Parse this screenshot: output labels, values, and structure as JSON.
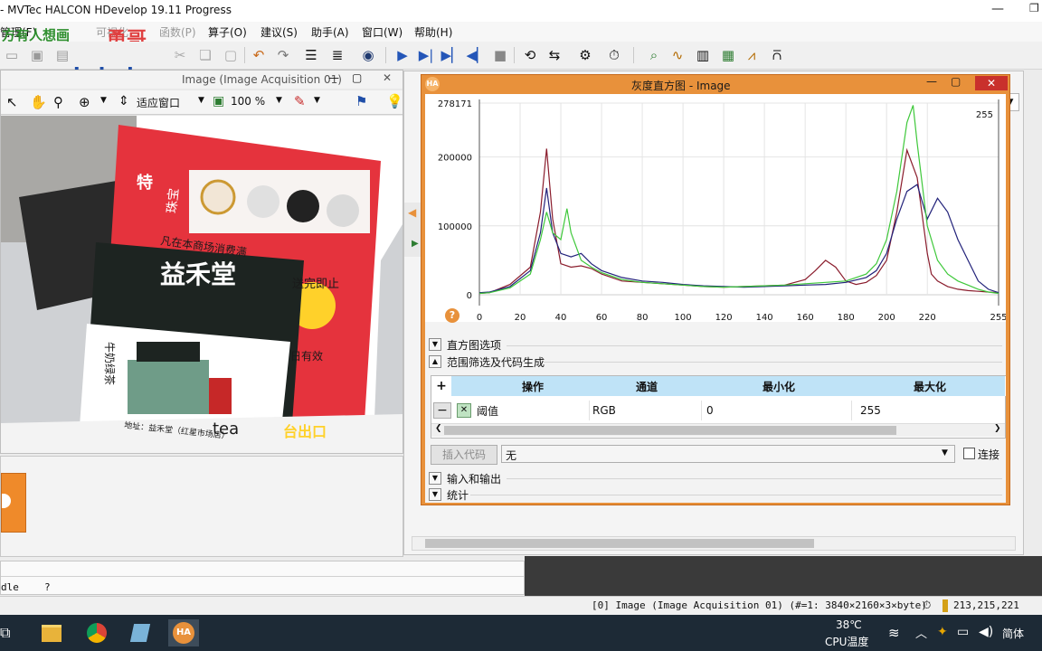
{
  "window": {
    "title": "- MVTec HALCON HDevelop 19.11 Progress",
    "watermark_left": "方有人想画",
    "watermark_brand": "勇哥",
    "watermark_url": "www.skcircle.com"
  },
  "menu": [
    {
      "label": "管理(F)"
    },
    {
      "label": "可视化"
    },
    {
      "label": "函数(P)"
    },
    {
      "label": "算子(O)"
    },
    {
      "label": "建议(S)"
    },
    {
      "label": "助手(A)"
    },
    {
      "label": "窗口(W)"
    },
    {
      "label": "帮助(H)"
    }
  ],
  "graphics_window": {
    "title": "Image (Image Acquisition 01)",
    "fit_label": "适应窗口",
    "zoom": "100 %",
    "photo_texts": {
      "brand": "益禾堂",
      "jewel": "珠宝",
      "special": "特",
      "promo": "凡在本商场消费满",
      "gift": "送完即止",
      "tea": "牛奶绿茶",
      "tea2": "tea",
      "valid": "日有效",
      "exit": "台出口",
      "addr": "地址：益禾堂（红星市场店）"
    }
  },
  "histogram": {
    "title": "灰度直方图 - Image",
    "sections": {
      "options": "直方图选项",
      "range": "范围筛选及代码生成",
      "io": "输入和输出",
      "stats": "统计"
    },
    "table": {
      "headers": [
        "操作",
        "通道",
        "最小化",
        "最大化"
      ],
      "rows": [
        {
          "op": "阈值",
          "channel": "RGB",
          "min": "0",
          "max": "255"
        }
      ]
    },
    "insert_code": "插入代码",
    "code_target": "无",
    "connect_label": "连接",
    "add_symbol": "+",
    "remove_symbol": "−"
  },
  "chart_data": {
    "type": "line",
    "x_ticks": [
      "0",
      "20",
      "40",
      "60",
      "80",
      "100",
      "120",
      "140",
      "160",
      "180",
      "200",
      "220",
      "255"
    ],
    "y_ticks": [
      "0",
      "100000",
      "200000",
      "278171"
    ],
    "marker_right": "255",
    "xlim": [
      0,
      255
    ],
    "ylim": [
      0,
      278171
    ],
    "grid": true,
    "series": [
      {
        "color": "#8a1c2c",
        "x": [
          0,
          5,
          15,
          25,
          30,
          33,
          36,
          40,
          45,
          50,
          55,
          60,
          70,
          80,
          90,
          100,
          110,
          120,
          130,
          140,
          150,
          160,
          165,
          170,
          175,
          180,
          185,
          190,
          195,
          200,
          205,
          210,
          215,
          220,
          222,
          225,
          230,
          235,
          240,
          245,
          250,
          255
        ],
        "y": [
          2000,
          3000,
          15000,
          40000,
          120000,
          212000,
          110000,
          45000,
          40000,
          42000,
          38000,
          30000,
          20000,
          18000,
          16000,
          14000,
          12000,
          11000,
          12000,
          13000,
          14000,
          22000,
          35000,
          50000,
          40000,
          20000,
          15000,
          18000,
          28000,
          50000,
          120000,
          210000,
          170000,
          60000,
          30000,
          20000,
          12000,
          8000,
          6000,
          5000,
          4000,
          3000
        ]
      },
      {
        "color": "#22227a",
        "x": [
          0,
          5,
          15,
          25,
          30,
          33,
          36,
          40,
          45,
          50,
          55,
          60,
          70,
          80,
          90,
          100,
          110,
          120,
          130,
          140,
          150,
          160,
          170,
          180,
          190,
          195,
          200,
          205,
          210,
          215,
          220,
          225,
          230,
          235,
          240,
          245,
          250,
          255
        ],
        "y": [
          3000,
          4000,
          12000,
          35000,
          90000,
          155000,
          90000,
          60000,
          55000,
          60000,
          45000,
          35000,
          25000,
          20000,
          18000,
          15000,
          13000,
          12000,
          11000,
          12000,
          13000,
          14000,
          15000,
          18000,
          25000,
          35000,
          60000,
          110000,
          150000,
          160000,
          110000,
          140000,
          120000,
          80000,
          50000,
          20000,
          8000,
          3000
        ]
      },
      {
        "color": "#3ec83a",
        "x": [
          0,
          5,
          15,
          25,
          30,
          33,
          36,
          40,
          43,
          45,
          50,
          55,
          60,
          70,
          80,
          90,
          100,
          110,
          120,
          130,
          140,
          150,
          160,
          170,
          180,
          190,
          195,
          200,
          205,
          210,
          213,
          215,
          220,
          225,
          230,
          235,
          240,
          245,
          250,
          255
        ],
        "y": [
          2000,
          3000,
          10000,
          30000,
          80000,
          120000,
          90000,
          80000,
          125000,
          90000,
          50000,
          40000,
          32000,
          22000,
          18000,
          16000,
          14000,
          12000,
          11000,
          12000,
          13000,
          14000,
          16000,
          18000,
          20000,
          30000,
          45000,
          80000,
          150000,
          250000,
          275000,
          220000,
          100000,
          50000,
          30000,
          20000,
          14000,
          8000,
          4000,
          2000
        ]
      }
    ]
  },
  "status_bar": {
    "info": "[0] Image (Image Acquisition 01) (#=1: 3840×2160×3×byte)",
    "rgb": "213,215,221"
  },
  "lower_panel": {
    "var_name": "dle",
    "var_value": "?"
  },
  "taskbar": {
    "temp": "38℃",
    "cpu_label": "CPU温度",
    "ime": "简体",
    "halcon_badge": "HA"
  }
}
